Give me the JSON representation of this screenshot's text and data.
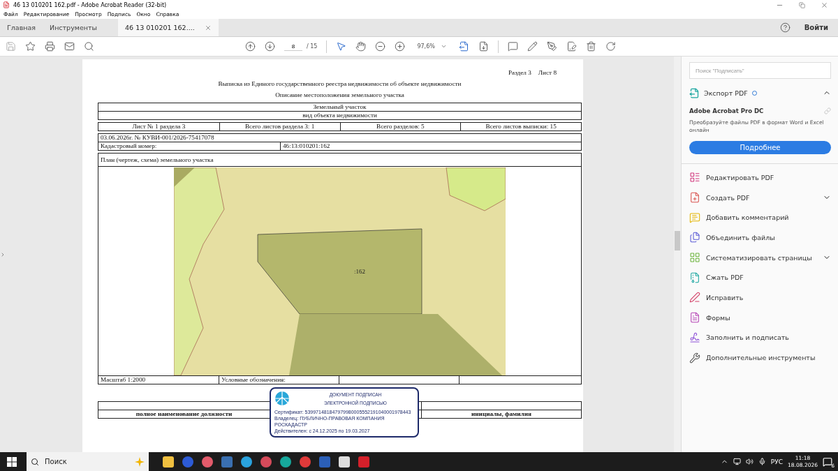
{
  "window": {
    "title": "46 13 010201 162.pdf - Adobe Acrobat Reader (32-bit)"
  },
  "menu": [
    "Файл",
    "Редактирование",
    "Просмотр",
    "Подпись",
    "Окно",
    "Справка"
  ],
  "tabs": [
    {
      "label": "Главная",
      "selected": false,
      "closable": false
    },
    {
      "label": "Инструменты",
      "selected": false,
      "closable": false
    },
    {
      "label": "46 13 010201 162....",
      "selected": true,
      "closable": true
    }
  ],
  "account": {
    "login": "Войти"
  },
  "toolbar": {
    "page_current": "8",
    "page_total": "/ 15",
    "zoom": "97,6%"
  },
  "document": {
    "page_label": [
      "Раздел 3",
      "Лист 8"
    ],
    "title": "Выписка из Единого государственного реестра недвижимости об объекте недвижимости",
    "subtitle": "Описание местоположения земельного участка",
    "object_type": "Земельный участок",
    "object_type_caption": "вид объекта недвижимости",
    "sheet_info": [
      "Лист № 1 раздела 3",
      "Всего листов раздела 3: 1",
      "Всего разделов: 5",
      "Всего листов выписки: 15"
    ],
    "extract_number": "03.06.2026г. № КУВИ-001/2026-75417078",
    "cadastral": {
      "label": "Кадастровый номер:",
      "value": "46:13:010201:162"
    },
    "plan": {
      "title": "План (чертеж, схема) земельного участка",
      "parcel_label": ":162"
    },
    "scale": "Масштаб 1:2000",
    "legend": "Условные обозначения:",
    "signature_row": {
      "position": "полное наименование должности",
      "name": "инициалы, фамилия"
    },
    "stamp": {
      "title_lines": [
        "ДОКУМЕНТ ПОДПИСАН",
        "ЭЛЕКТРОННОЙ ПОДПИСЬЮ"
      ],
      "certificate": "Сертификат: 539971481847979980005552191040001978443",
      "owner": "Владелец: ПУБЛИЧНО-ПРАВОВАЯ КОМПАНИЯ РОСКАДАСТР",
      "valid": "Действителен: с 24.12.2025 по 19.03.2027"
    }
  },
  "right_panel": {
    "search": {
      "placeholder": "Поиск \"Подписать\""
    },
    "export": {
      "label": "Экспорт PDF",
      "expanded": true
    },
    "promo": {
      "title": "Adobe Acrobat Pro DC",
      "text": "Преобразуйте файлы PDF в формат Word и Excel онлайн",
      "button": "Подробнее"
    },
    "tools": [
      {
        "label": "Редактировать PDF",
        "kind": "edit",
        "has_submenu": false
      },
      {
        "label": "Создать PDF",
        "kind": "create",
        "has_submenu": true
      },
      {
        "label": "Добавить комментарий",
        "kind": "comment",
        "has_submenu": false
      },
      {
        "label": "Объединить файлы",
        "kind": "combine",
        "has_submenu": false
      },
      {
        "label": "Систематизировать страницы",
        "kind": "organize",
        "has_submenu": true
      },
      {
        "label": "Сжать PDF",
        "kind": "compress",
        "has_submenu": false
      },
      {
        "label": "Исправить",
        "kind": "fix",
        "has_submenu": false
      },
      {
        "label": "Формы",
        "kind": "forms",
        "has_submenu": false
      },
      {
        "label": "Заполнить и подписать",
        "kind": "sign",
        "has_submenu": false
      },
      {
        "label": "Дополнительные инструменты",
        "kind": "more",
        "has_submenu": false
      }
    ]
  },
  "taskbar": {
    "search": {
      "placeholder": "Поиск"
    },
    "language": "РУС",
    "time": "11:18",
    "date": "18.08.2026",
    "notifications": "6"
  }
}
